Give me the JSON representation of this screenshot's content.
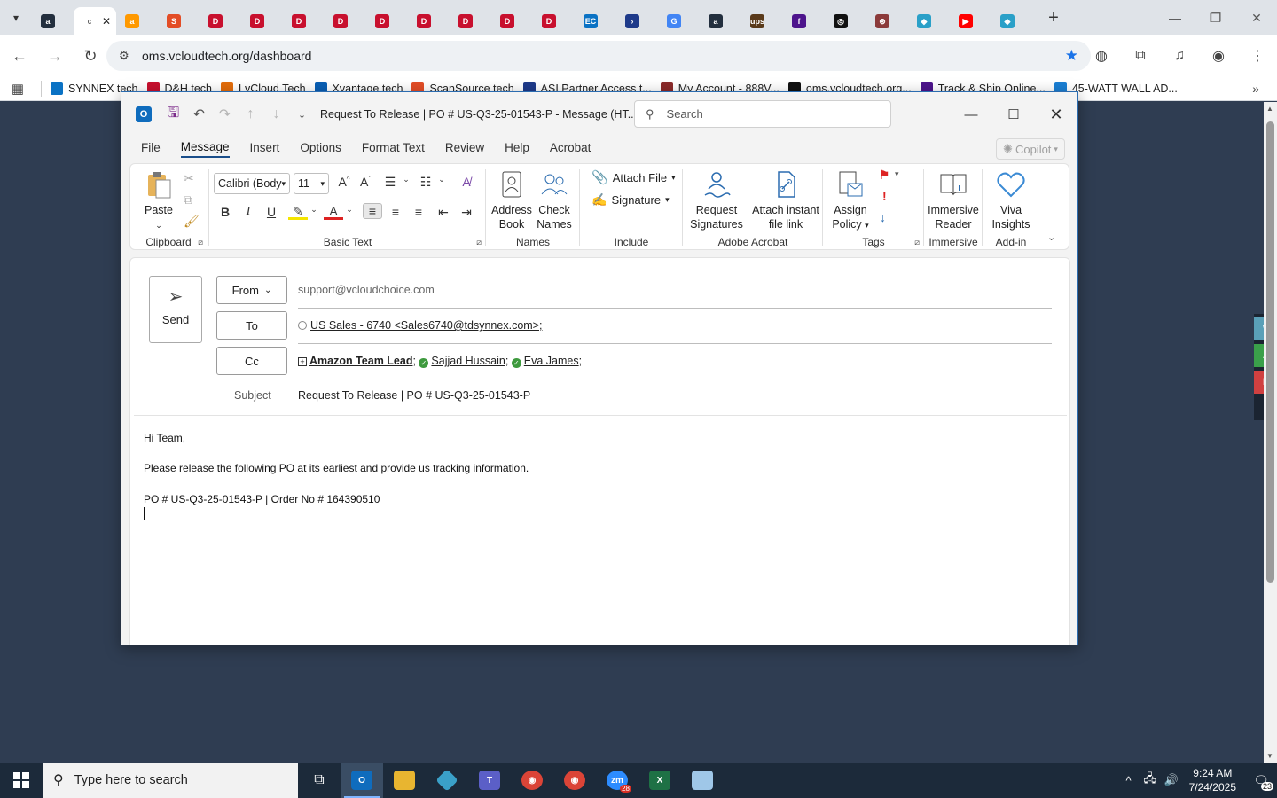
{
  "browser": {
    "tabs": [
      {
        "name": "amazon",
        "color": "#232f3e",
        "glyph": "a",
        "active": false
      },
      {
        "name": "active-tab",
        "color": "#ffffff",
        "glyph": "",
        "active": true
      },
      {
        "name": "amazon-2",
        "color": "#ff9900",
        "glyph": "a",
        "active": false
      },
      {
        "name": "scansource",
        "color": "#e34d26",
        "glyph": "S",
        "active": false
      },
      {
        "name": "dh-1",
        "color": "#c8102e",
        "glyph": "D",
        "active": false
      },
      {
        "name": "dh-2",
        "color": "#c8102e",
        "glyph": "D",
        "active": false
      },
      {
        "name": "dh-3",
        "color": "#c8102e",
        "glyph": "D",
        "active": false
      },
      {
        "name": "dh-4",
        "color": "#c8102e",
        "glyph": "D",
        "active": false
      },
      {
        "name": "dh-5",
        "color": "#c8102e",
        "glyph": "D",
        "active": false
      },
      {
        "name": "dh-6",
        "color": "#c8102e",
        "glyph": "D",
        "active": false
      },
      {
        "name": "dh-7",
        "color": "#c8102e",
        "glyph": "D",
        "active": false
      },
      {
        "name": "dh-8",
        "color": "#c8102e",
        "glyph": "D",
        "active": false
      },
      {
        "name": "dh-9",
        "color": "#c8102e",
        "glyph": "D",
        "active": false
      },
      {
        "name": "synnex",
        "color": "#0a72c4",
        "glyph": "EC",
        "active": false
      },
      {
        "name": "asi",
        "color": "#1e3a8a",
        "glyph": "›",
        "active": false
      },
      {
        "name": "google",
        "color": "#4285f4",
        "glyph": "G",
        "active": false
      },
      {
        "name": "amazon-3",
        "color": "#232f3e",
        "glyph": "a",
        "active": false
      },
      {
        "name": "ups",
        "color": "#5a3a1a",
        "glyph": "ups",
        "active": false
      },
      {
        "name": "fedex",
        "color": "#4d148c",
        "glyph": "f",
        "active": false
      },
      {
        "name": "openai",
        "color": "#111111",
        "glyph": "◎",
        "active": false
      },
      {
        "name": "ext",
        "color": "#8b3a3a",
        "glyph": "⊛",
        "active": false
      },
      {
        "name": "ext-2",
        "color": "#2aa0c8",
        "glyph": "◆",
        "active": false
      },
      {
        "name": "youtube",
        "color": "#ff0000",
        "glyph": "▶",
        "active": false
      },
      {
        "name": "ext-3",
        "color": "#2aa0c8",
        "glyph": "◆",
        "active": false
      }
    ],
    "active_tab_label": "c",
    "url": "oms.vcloudtech.org/dashboard",
    "bookmarks": [
      {
        "label": "SYNNEX tech",
        "color": "#0a72c4"
      },
      {
        "label": "D&H tech",
        "color": "#c8102e"
      },
      {
        "label": "LvCloud Tech",
        "color": "#e36c0a"
      },
      {
        "label": "Xvantage tech",
        "color": "#0a5fb4"
      },
      {
        "label": "ScanSource tech",
        "color": "#e34d26"
      },
      {
        "label": "ASI Partner Access t...",
        "color": "#1e3a8a"
      },
      {
        "label": "My Account - 888V...",
        "color": "#8b2a2a"
      },
      {
        "label": "oms.vcloudtech.org...",
        "color": "#111111"
      },
      {
        "label": "Track & Ship Online...",
        "color": "#4d148c"
      },
      {
        "label": "45-WATT WALL AD...",
        "color": "#1a7fd4"
      }
    ]
  },
  "outlook": {
    "window_title": "Request To Release | PO # US-Q3-25-01543-P  -  Message (HT...",
    "search_placeholder": "Search",
    "menu": [
      "File",
      "Message",
      "Insert",
      "Options",
      "Format Text",
      "Review",
      "Help",
      "Acrobat"
    ],
    "copilot_label": "Copilot",
    "ribbon": {
      "clipboard": {
        "paste": "Paste",
        "label": "Clipboard"
      },
      "basic_text": {
        "font": "Calibri (Body",
        "size": "11",
        "label": "Basic Text"
      },
      "names": {
        "address_book": "Address Book",
        "check_names": "Check Names",
        "label": "Names"
      },
      "include": {
        "attach_file": "Attach File",
        "signature": "Signature",
        "label": "Include"
      },
      "acrobat": {
        "request_signatures": "Request Signatures",
        "attach_link": "Attach instant file link",
        "label": "Adobe Acrobat"
      },
      "tags": {
        "assign_policy": "Assign Policy",
        "label": "Tags"
      },
      "immersive": {
        "reader": "Immersive Reader",
        "label": "Immersive"
      },
      "addin": {
        "viva": "Viva Insights",
        "label": "Add-in"
      }
    },
    "compose": {
      "send": "Send",
      "from_label": "From",
      "from_value": "support@vcloudchoice.com",
      "to_label": "To",
      "to_value": "US Sales - 6740 <Sales6740@tdsynnex.com>;",
      "cc_label": "Cc",
      "cc_recipients": [
        "Amazon Team Lead",
        "Sajjad Hussain",
        "Eva James"
      ],
      "subject_label": "Subject",
      "subject_value": "Request To Release | PO # US-Q3-25-01543-P",
      "body": [
        "Hi Team,",
        "Please release the following PO at its earliest and provide us tracking information.",
        "PO # US-Q3-25-01543-P | Order No # 164390510"
      ]
    }
  },
  "taskbar": {
    "search_placeholder": "Type here to search",
    "time": "9:24 AM",
    "date": "7/24/2025",
    "notification_count": "23",
    "zoom_badge": "28"
  }
}
